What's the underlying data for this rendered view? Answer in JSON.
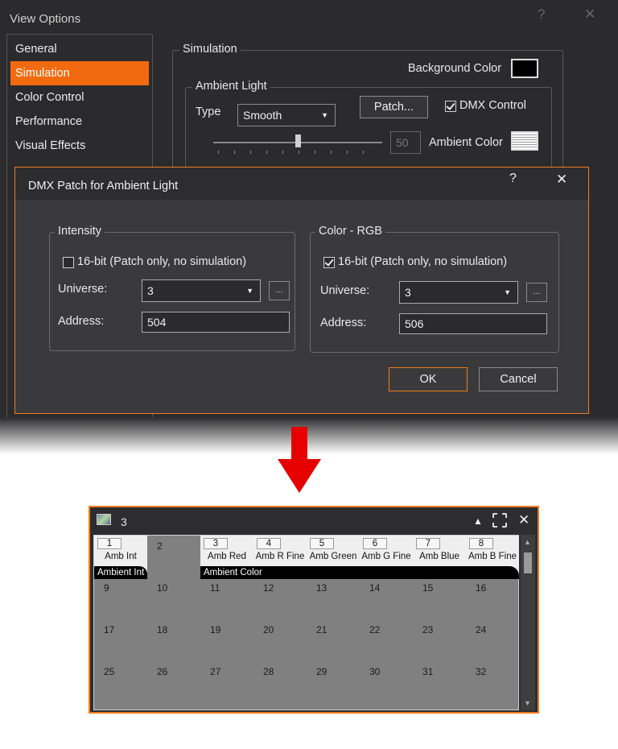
{
  "view_options": {
    "title": "View Options",
    "help": "?",
    "close": "✕",
    "nav": [
      {
        "label": "General"
      },
      {
        "label": "Simulation"
      },
      {
        "label": "Color Control"
      },
      {
        "label": "Performance"
      },
      {
        "label": "Visual Effects"
      }
    ],
    "simulation": {
      "legend": "Simulation",
      "background_color_label": "Background Color",
      "background_color": "#000000",
      "ambient": {
        "legend": "Ambient Light",
        "type_label": "Type",
        "type_value": "Smooth",
        "patch_button": "Patch...",
        "dmx_control_label": "DMX Control",
        "dmx_control_checked": true,
        "slider_value": "50",
        "ambient_color_label": "Ambient Color"
      }
    }
  },
  "dmx_patch": {
    "title": "DMX Patch for Ambient Light",
    "help": "?",
    "close": "✕",
    "intensity": {
      "legend": "Intensity",
      "sixteen_bit_label": "16-bit (Patch only, no simulation)",
      "sixteen_bit_checked": false,
      "universe_label": "Universe:",
      "universe_value": "3",
      "address_label": "Address:",
      "address_value": "504",
      "ellipsis": "..."
    },
    "color": {
      "legend": "Color - RGB",
      "sixteen_bit_label": "16-bit (Patch only, no simulation)",
      "sixteen_bit_checked": true,
      "universe_label": "Universe:",
      "universe_value": "3",
      "address_label": "Address:",
      "address_value": "506",
      "ellipsis": "..."
    },
    "ok": "OK",
    "cancel": "Cancel"
  },
  "arrow_color": "#e60000",
  "accent_color": "#f26a0f",
  "patch_grid": {
    "title": "3",
    "controls": {
      "up": "▲",
      "close": "✕"
    },
    "cells": [
      {
        "num": "1",
        "name": "Amb Int",
        "patched": true
      },
      {
        "num": "2",
        "name": "",
        "patched": false
      },
      {
        "num": "3",
        "name": "Amb Red",
        "patched": true
      },
      {
        "num": "4",
        "name": "Amb R Fine",
        "patched": true
      },
      {
        "num": "5",
        "name": "Amb Green",
        "patched": true
      },
      {
        "num": "6",
        "name": "Amb G Fine",
        "patched": true
      },
      {
        "num": "7",
        "name": "Amb Blue",
        "patched": true
      },
      {
        "num": "8",
        "name": "Amb B Fine",
        "patched": true
      },
      {
        "num": "9"
      },
      {
        "num": "10"
      },
      {
        "num": "11"
      },
      {
        "num": "12"
      },
      {
        "num": "13"
      },
      {
        "num": "14"
      },
      {
        "num": "15"
      },
      {
        "num": "16"
      },
      {
        "num": "17"
      },
      {
        "num": "18"
      },
      {
        "num": "19"
      },
      {
        "num": "20"
      },
      {
        "num": "21"
      },
      {
        "num": "22"
      },
      {
        "num": "23"
      },
      {
        "num": "24"
      },
      {
        "num": "25"
      },
      {
        "num": "26"
      },
      {
        "num": "27"
      },
      {
        "num": "28"
      },
      {
        "num": "29"
      },
      {
        "num": "30"
      },
      {
        "num": "31"
      },
      {
        "num": "32"
      }
    ],
    "fixtures": [
      {
        "label": "Ambient Int"
      },
      {
        "label": "Ambient Color"
      }
    ]
  }
}
